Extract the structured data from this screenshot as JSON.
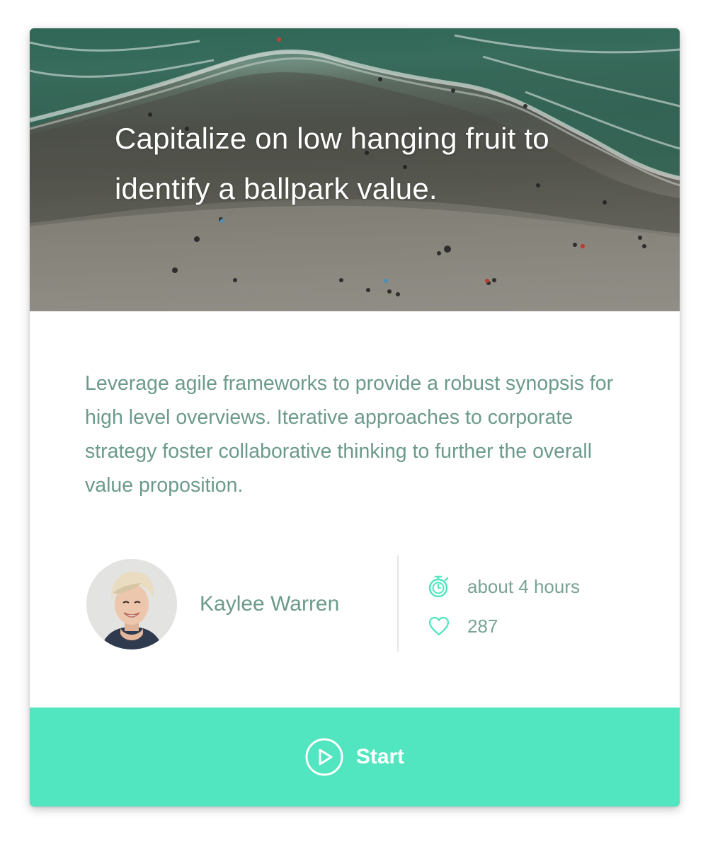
{
  "hero": {
    "title": "Capitalize on low hanging fruit to identify a ballpark value."
  },
  "description": "Leverage agile frameworks to provide a robust synopsis for high level overviews. Iterative approaches to corporate strategy foster collaborative thinking to further the overall value proposition.",
  "author": {
    "name": "Kaylee Warren"
  },
  "meta": {
    "duration": "about 4 hours",
    "likes": "287",
    "duration_icon": "stopwatch-icon",
    "likes_icon": "heart-icon"
  },
  "action": {
    "start_label": "Start",
    "icon": "play-circle-icon"
  },
  "colors": {
    "accent": "#51e5c0",
    "text_muted": "#6c9a8c",
    "icon": "#51e5c0"
  }
}
